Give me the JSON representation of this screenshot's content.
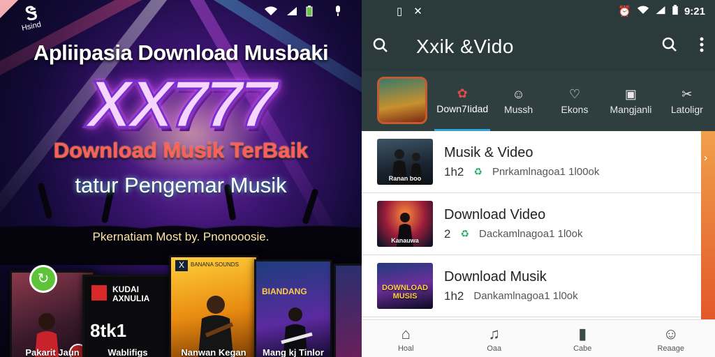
{
  "promo": {
    "corner_logo": "Ꮥ",
    "corner_sub": "Hsind",
    "status_icons": [
      "wifi-icon",
      "signal-icon",
      "battery-icon",
      "mic-icon"
    ],
    "headline": "Apliipasia Download Musbaki",
    "logo": "XX777",
    "tagline1": "Download Musik TerBaik",
    "tagline2": "tatur Pengemar Musik",
    "tagline3": "Pkernatiam Most by. Pnonooosie.",
    "cards": [
      {
        "caption": "Pakarit Jaun"
      },
      {
        "title": "KUDAI AXNULIA",
        "number": "8tk1",
        "caption": "Wablifigs"
      },
      {
        "title": "BANANA SOUNDS",
        "caption": "Nanwan Kegan"
      },
      {
        "title": "BIANDANG",
        "caption": "Mang kj Tinlor"
      },
      {
        "title": ""
      }
    ]
  },
  "phone": {
    "status": {
      "left_icons": [
        "sim-icon",
        "x-icon"
      ],
      "time": "9:21"
    },
    "appbar": {
      "title": "Xxik &Vido"
    },
    "tabs": [
      {
        "label": "Down7Iidad",
        "icon": "✿",
        "active": true
      },
      {
        "label": "Mussh",
        "icon": "☺",
        "active": false
      },
      {
        "label": "Ekons",
        "icon": "♡",
        "active": false
      },
      {
        "label": "Mangjanli",
        "icon": "▣",
        "active": false
      },
      {
        "label": "Latoligr",
        "icon": "✂",
        "active": false
      }
    ],
    "list": [
      {
        "name": "Musik  &  Video",
        "num": "1h2",
        "desc": "Pnrkamlnagoa1 1l00ok",
        "thumb_caption": "Ranan boo"
      },
      {
        "name": "Download Video",
        "num": "2",
        "desc": "Dackamlnagoa1 1l0ok",
        "thumb_caption": "Kanauwa"
      },
      {
        "name": "Download Musik",
        "num": "1h2",
        "desc": "Dankamlnagoa1 1l0ok",
        "thumb_caption": "DOWNLOAD MUSIS"
      }
    ],
    "bottom_nav": [
      {
        "label": "Hoal",
        "icon": "⌂"
      },
      {
        "label": "Oaa",
        "icon": "♫"
      },
      {
        "label": "Cabe",
        "icon": "▮"
      },
      {
        "label": "Reaage",
        "icon": "☺"
      }
    ],
    "colors": {
      "header": "#2b3b3b",
      "active_tab": "#33a3dc",
      "accent_strip": "#e2582a"
    }
  }
}
